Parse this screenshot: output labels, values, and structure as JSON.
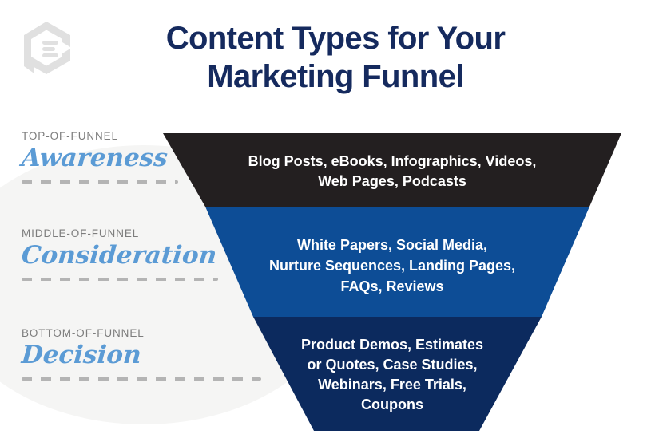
{
  "brand": {
    "logo_icon": "content-document-hexagon-logo",
    "logo_color": "#e0e0e0",
    "title_color": "#152a5e",
    "script_color": "#5b9bd5",
    "eyebrow_color": "#7d7d7d",
    "dash_color": "#b4b4b4",
    "blob_color": "#f5f5f4"
  },
  "header": {
    "title_line1": "Content Types for Your",
    "title_line2": "Marketing Funnel"
  },
  "stages": [
    {
      "eyebrow": "TOP-OF-FUNNEL",
      "name": "Awareness",
      "band_color": "#231f20",
      "content_lines": [
        "Blog Posts, eBooks, Infographics, Videos,",
        "Web Pages, Podcasts"
      ],
      "content_items": [
        "Blog Posts",
        "eBooks",
        "Infographics",
        "Videos",
        "Web Pages",
        "Podcasts"
      ]
    },
    {
      "eyebrow": "MIDDLE-OF-FUNNEL",
      "name": "Consideration",
      "band_color": "#0d4d96",
      "content_lines": [
        "White Papers, Social Media,",
        "Nurture Sequences, Landing Pages,",
        "FAQs, Reviews"
      ],
      "content_items": [
        "White Papers",
        "Social Media",
        "Nurture Sequences",
        "Landing Pages",
        "FAQs",
        "Reviews"
      ]
    },
    {
      "eyebrow": "BOTTOM-OF-FUNNEL",
      "name": "Decision",
      "band_color": "#0c2a5e",
      "content_lines": [
        "Product Demos, Estimates",
        "or Quotes, Case Studies,",
        "Webinars, Free Trials,",
        "Coupons"
      ],
      "content_items": [
        "Product Demos",
        "Estimates or Quotes",
        "Case Studies",
        "Webinars",
        "Free Trials",
        "Coupons"
      ]
    }
  ]
}
